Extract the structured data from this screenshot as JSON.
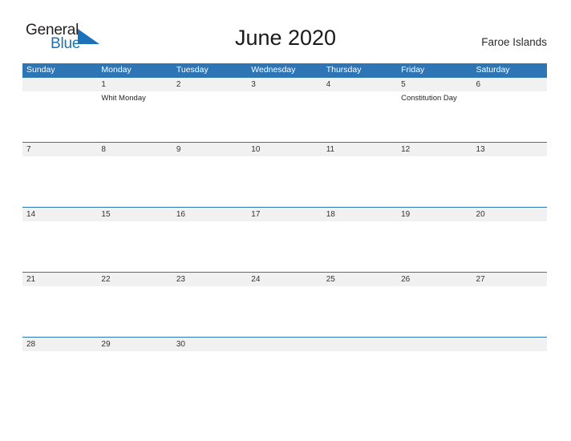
{
  "brand": {
    "name_part1": "General",
    "name_part2": "Blue",
    "flag_icon": "flag-triangle-icon",
    "blue": "#1b72b8"
  },
  "header": {
    "title": "June 2020",
    "region": "Faroe Islands",
    "accent_color": "#2e75b6",
    "band_color": "#f1f1f1"
  },
  "calendar": {
    "day_headers": [
      "Sunday",
      "Monday",
      "Tuesday",
      "Wednesday",
      "Thursday",
      "Friday",
      "Saturday"
    ],
    "weeks": [
      {
        "days": [
          {
            "date": "",
            "event": ""
          },
          {
            "date": "1",
            "event": "Whit Monday"
          },
          {
            "date": "2",
            "event": ""
          },
          {
            "date": "3",
            "event": ""
          },
          {
            "date": "4",
            "event": ""
          },
          {
            "date": "5",
            "event": "Constitution Day"
          },
          {
            "date": "6",
            "event": ""
          }
        ]
      },
      {
        "days": [
          {
            "date": "7",
            "event": ""
          },
          {
            "date": "8",
            "event": ""
          },
          {
            "date": "9",
            "event": ""
          },
          {
            "date": "10",
            "event": ""
          },
          {
            "date": "11",
            "event": ""
          },
          {
            "date": "12",
            "event": ""
          },
          {
            "date": "13",
            "event": ""
          }
        ]
      },
      {
        "days": [
          {
            "date": "14",
            "event": ""
          },
          {
            "date": "15",
            "event": ""
          },
          {
            "date": "16",
            "event": ""
          },
          {
            "date": "17",
            "event": ""
          },
          {
            "date": "18",
            "event": ""
          },
          {
            "date": "19",
            "event": ""
          },
          {
            "date": "20",
            "event": ""
          }
        ]
      },
      {
        "days": [
          {
            "date": "21",
            "event": ""
          },
          {
            "date": "22",
            "event": ""
          },
          {
            "date": "23",
            "event": ""
          },
          {
            "date": "24",
            "event": ""
          },
          {
            "date": "25",
            "event": ""
          },
          {
            "date": "26",
            "event": ""
          },
          {
            "date": "27",
            "event": ""
          }
        ]
      },
      {
        "days": [
          {
            "date": "28",
            "event": ""
          },
          {
            "date": "29",
            "event": ""
          },
          {
            "date": "30",
            "event": ""
          },
          {
            "date": "",
            "event": ""
          },
          {
            "date": "",
            "event": ""
          },
          {
            "date": "",
            "event": ""
          },
          {
            "date": "",
            "event": ""
          }
        ]
      }
    ]
  }
}
